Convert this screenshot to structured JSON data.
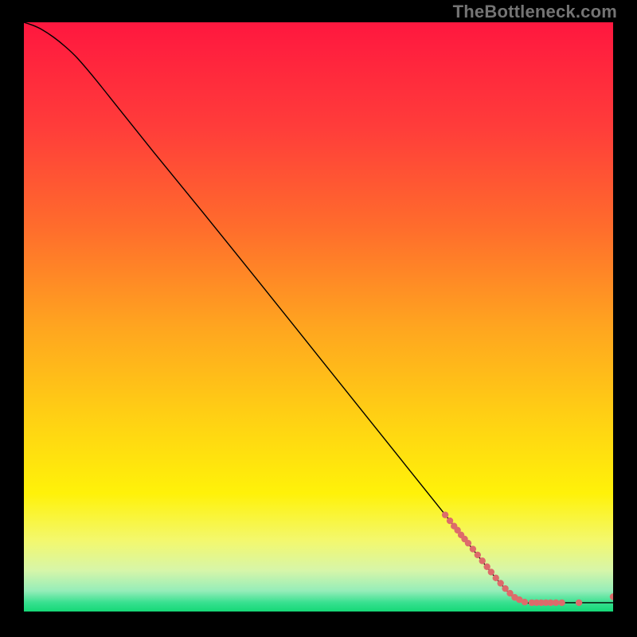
{
  "attribution": "TheBottleneck.com",
  "chart_data": {
    "type": "line",
    "title": "",
    "xlabel": "",
    "ylabel": "",
    "xlim": [
      0,
      100
    ],
    "ylim": [
      0,
      100
    ],
    "grid": false,
    "legend": false,
    "gradient_stops": [
      {
        "pos": 0.0,
        "color": "#ff173f"
      },
      {
        "pos": 0.18,
        "color": "#ff3d3a"
      },
      {
        "pos": 0.35,
        "color": "#ff6d2c"
      },
      {
        "pos": 0.52,
        "color": "#ffa61f"
      },
      {
        "pos": 0.68,
        "color": "#ffd313"
      },
      {
        "pos": 0.8,
        "color": "#fff209"
      },
      {
        "pos": 0.88,
        "color": "#f3f86e"
      },
      {
        "pos": 0.93,
        "color": "#d7f6a9"
      },
      {
        "pos": 0.965,
        "color": "#95edb9"
      },
      {
        "pos": 0.985,
        "color": "#37e08f"
      },
      {
        "pos": 1.0,
        "color": "#15d877"
      }
    ],
    "series": [
      {
        "name": "bottleneck-curve",
        "color": "#000000",
        "width": 1.4,
        "points": [
          {
            "x": 0.0,
            "y": 100.0
          },
          {
            "x": 1.5,
            "y": 99.5
          },
          {
            "x": 3.0,
            "y": 98.8
          },
          {
            "x": 5.0,
            "y": 97.5
          },
          {
            "x": 7.0,
            "y": 95.9
          },
          {
            "x": 9.0,
            "y": 94.0
          },
          {
            "x": 12.0,
            "y": 90.5
          },
          {
            "x": 16.0,
            "y": 85.5
          },
          {
            "x": 22.0,
            "y": 78.0
          },
          {
            "x": 30.0,
            "y": 68.2
          },
          {
            "x": 40.0,
            "y": 55.8
          },
          {
            "x": 50.0,
            "y": 43.3
          },
          {
            "x": 60.0,
            "y": 30.8
          },
          {
            "x": 70.0,
            "y": 18.3
          },
          {
            "x": 76.0,
            "y": 10.8
          },
          {
            "x": 80.0,
            "y": 5.8
          },
          {
            "x": 83.0,
            "y": 2.5
          },
          {
            "x": 85.0,
            "y": 1.5
          },
          {
            "x": 87.0,
            "y": 1.5
          },
          {
            "x": 90.0,
            "y": 1.5
          },
          {
            "x": 95.0,
            "y": 1.5
          },
          {
            "x": 100.0,
            "y": 1.5
          }
        ]
      }
    ],
    "scatter": [
      {
        "name": "highlight-points",
        "color": "#dd6b6b",
        "radius": 4.2,
        "points": [
          {
            "x": 71.5,
            "y": 16.4
          },
          {
            "x": 72.3,
            "y": 15.4
          },
          {
            "x": 73.0,
            "y": 14.5
          },
          {
            "x": 73.6,
            "y": 13.8
          },
          {
            "x": 74.2,
            "y": 13.0
          },
          {
            "x": 74.8,
            "y": 12.3
          },
          {
            "x": 75.4,
            "y": 11.6
          },
          {
            "x": 76.2,
            "y": 10.6
          },
          {
            "x": 77.0,
            "y": 9.6
          },
          {
            "x": 77.8,
            "y": 8.6
          },
          {
            "x": 78.6,
            "y": 7.6
          },
          {
            "x": 79.3,
            "y": 6.7
          },
          {
            "x": 80.1,
            "y": 5.7
          },
          {
            "x": 80.9,
            "y": 4.8
          },
          {
            "x": 81.7,
            "y": 3.9
          },
          {
            "x": 82.5,
            "y": 3.1
          },
          {
            "x": 83.3,
            "y": 2.4
          },
          {
            "x": 84.1,
            "y": 2.0
          },
          {
            "x": 85.0,
            "y": 1.6
          },
          {
            "x": 86.2,
            "y": 1.5
          },
          {
            "x": 87.0,
            "y": 1.5
          },
          {
            "x": 87.8,
            "y": 1.5
          },
          {
            "x": 88.6,
            "y": 1.5
          },
          {
            "x": 89.4,
            "y": 1.5
          },
          {
            "x": 90.3,
            "y": 1.5
          },
          {
            "x": 91.3,
            "y": 1.5
          },
          {
            "x": 94.2,
            "y": 1.5
          },
          {
            "x": 100.0,
            "y": 2.5
          }
        ]
      }
    ]
  }
}
